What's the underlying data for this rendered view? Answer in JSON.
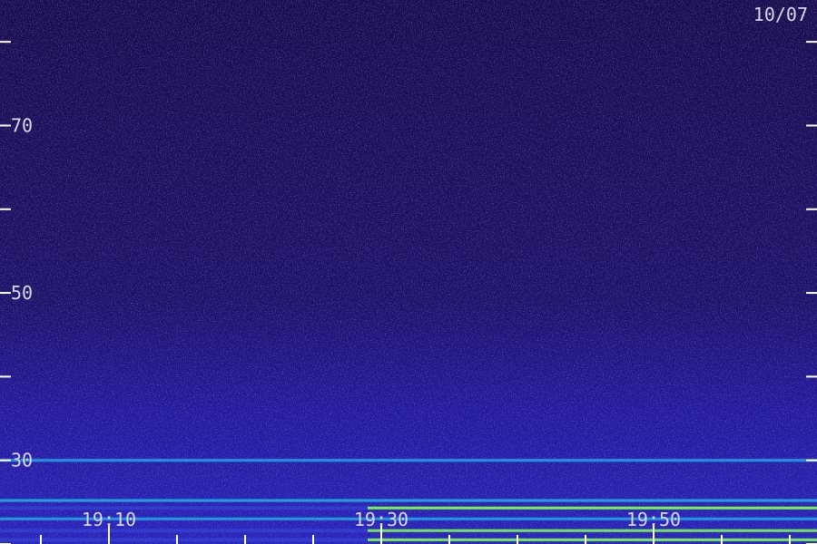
{
  "chart_data": {
    "type": "heatmap",
    "title": "",
    "date_label": "10/07",
    "xlabel": "",
    "ylabel": "",
    "x_time_range": [
      "19:02",
      "20:02"
    ],
    "x_tick_labels": [
      "19:10",
      "19:30",
      "19:50"
    ],
    "x_major_ticks": [
      "19:10",
      "19:30",
      "19:50"
    ],
    "y_range": [
      20,
      85
    ],
    "y_tick_labels": [
      30,
      50,
      70
    ],
    "y_ticks_unlabeled": [
      20,
      40,
      60,
      80
    ],
    "emission_bands": [
      {
        "y": 30.0,
        "intensity": 0.55
      },
      {
        "y": 25.2,
        "intensity": 0.7
      },
      {
        "y": 24.3,
        "intensity": 0.95
      },
      {
        "y": 23.0,
        "intensity": 0.6
      },
      {
        "y": 21.6,
        "intensity": 0.85
      },
      {
        "y": 20.5,
        "intensity": 0.9
      }
    ],
    "colormap": [
      "#120838",
      "#2a1a9a",
      "#2f4ee0",
      "#1fb8e0",
      "#7cff40"
    ],
    "grid": false,
    "legend": "none"
  }
}
